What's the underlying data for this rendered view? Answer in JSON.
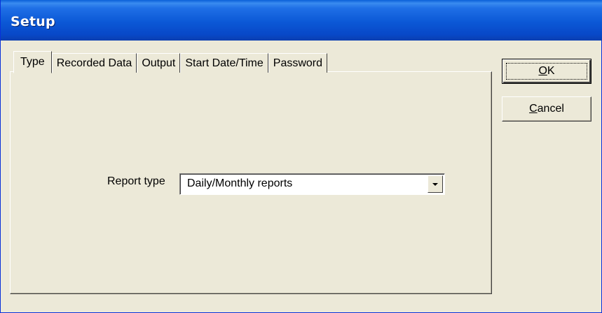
{
  "window": {
    "title": "Setup"
  },
  "tabs": [
    {
      "label": "Type",
      "active": true
    },
    {
      "label": "Recorded Data",
      "active": false
    },
    {
      "label": "Output",
      "active": false
    },
    {
      "label": "Start Date/Time",
      "active": false
    },
    {
      "label": "Password",
      "active": false
    }
  ],
  "form": {
    "report_type_label": "Report type",
    "report_type_value": "Daily/Monthly reports"
  },
  "buttons": {
    "ok": {
      "mnemonic": "O",
      "rest": "K"
    },
    "cancel": {
      "mnemonic": "C",
      "rest": "ancel"
    }
  },
  "colors": {
    "titlebar": "#0b58d6",
    "face": "#ece9d8"
  }
}
